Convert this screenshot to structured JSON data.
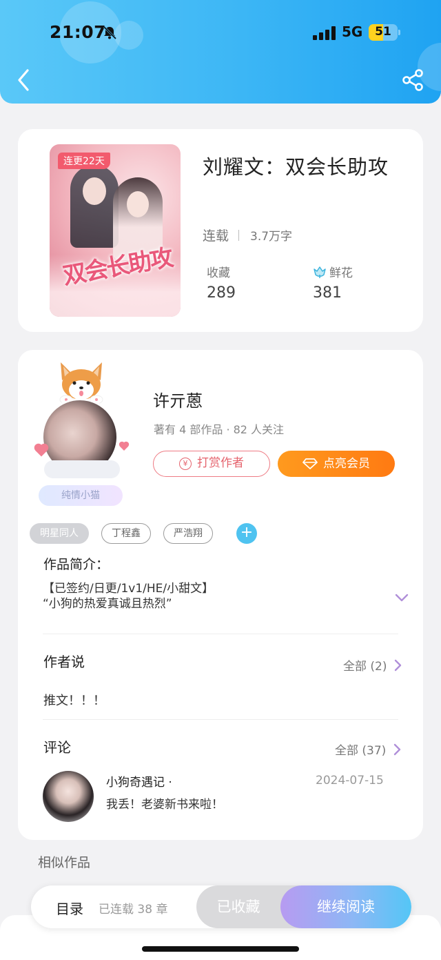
{
  "status_bar": {
    "time": "21:07",
    "network": "5G",
    "battery": "51"
  },
  "book": {
    "badge": "连更22天",
    "cover_title": "双会长助攻",
    "title": "刘耀文：双会长助攻",
    "status": "连载",
    "word_count": "3.7万字",
    "favorites_label": "收藏",
    "favorites_value": "289",
    "flowers_label": "鲜花",
    "flowers_value": "381"
  },
  "author": {
    "name": "许亓蒽",
    "meta": "著有 4 部作品 · 82 人关注",
    "avatar_tag": "纯情小猫",
    "tip_button": "打赏作者",
    "vip_button": "点亮会员"
  },
  "tags": [
    "明星同人",
    "丁程鑫",
    "严浩翔"
  ],
  "intro": {
    "title": "作品简介：",
    "line1": "【已签约/日更/1v1/HE/小甜文】",
    "line2": "“小狗的热爱真诚且热烈”"
  },
  "author_says": {
    "title": "作者说",
    "more": "全部 (2)",
    "text": "推文！！！"
  },
  "comments": {
    "title": "评论",
    "more": "全部 (37)",
    "items": [
      {
        "user": "小狗奇遇记 ·",
        "date": "2024-07-15",
        "text": "我丢！老婆新书来啦！"
      }
    ]
  },
  "similar_title": "相似作品",
  "bottom_bar": {
    "toc": "目录",
    "chapters": "已连载 38 章",
    "collected": "已收藏",
    "continue": "继续阅读"
  }
}
